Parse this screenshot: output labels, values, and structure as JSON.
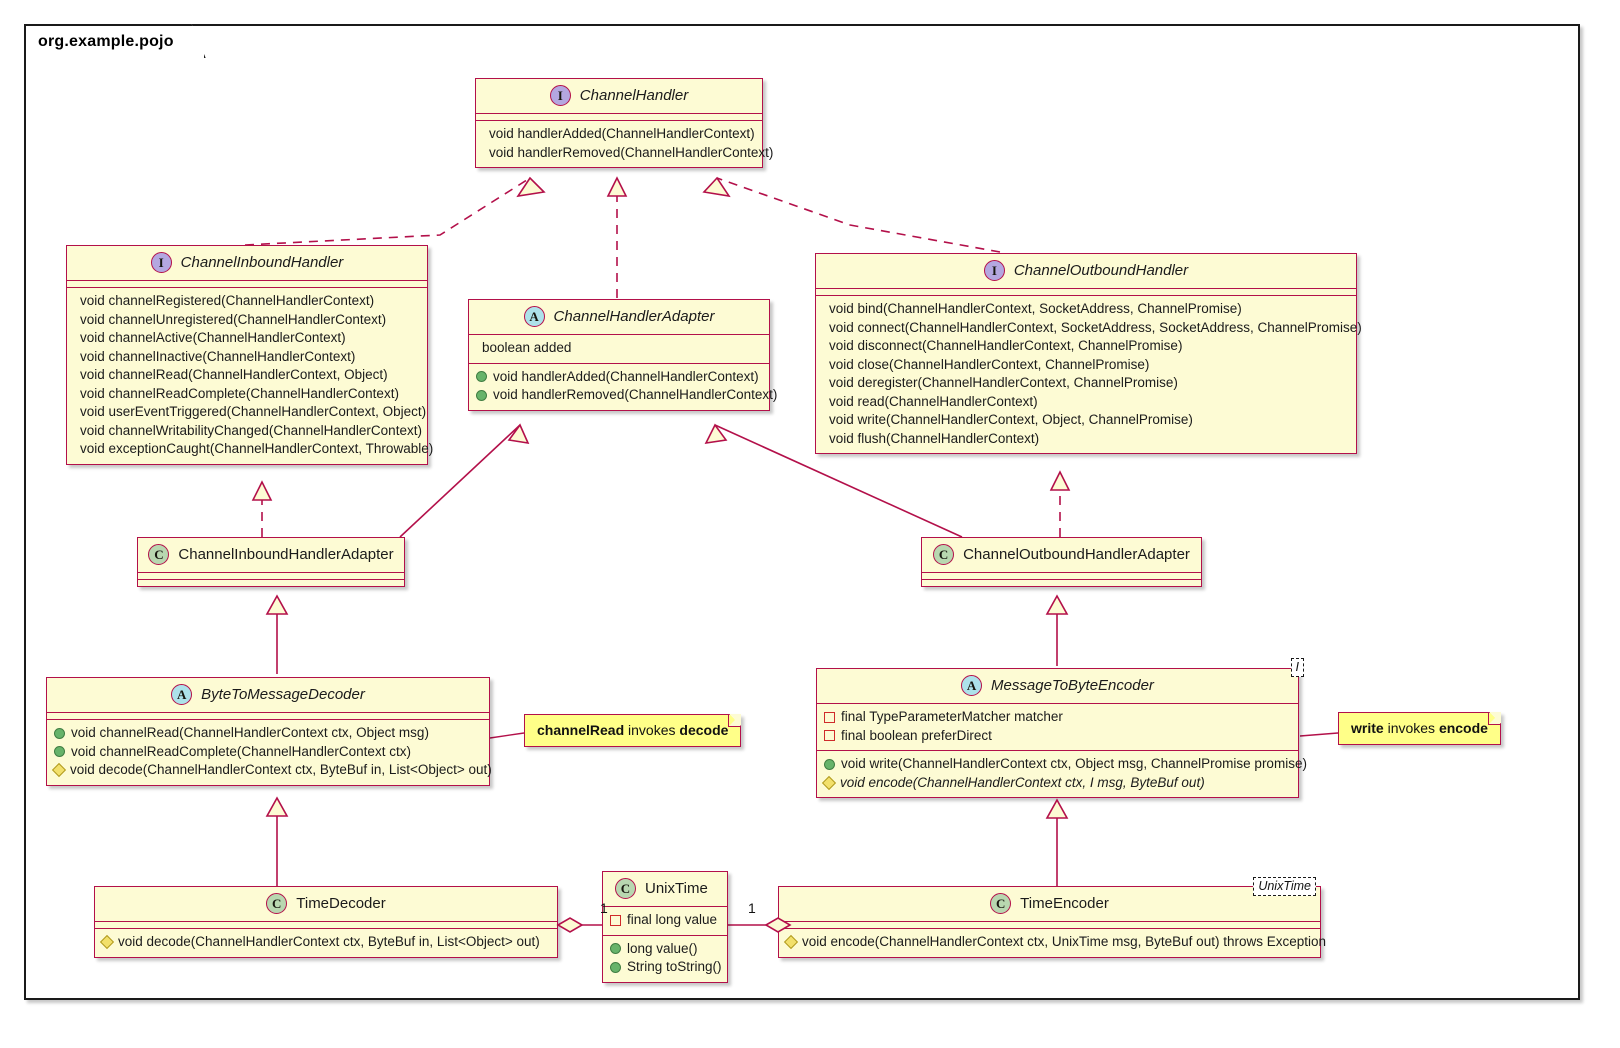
{
  "package": {
    "name": "org.example.pojo"
  },
  "colors": {
    "class_fill": "#fdfbd4",
    "class_border": "#b3104a",
    "note_fill": "#ffff88",
    "interface_icon": "#b4a7e0",
    "abstract_icon": "#ade2ea",
    "class_icon": "#b8d7b0",
    "public_marker": "#67b36a",
    "protected_marker": "#f2e06a",
    "private_marker": "#cf2b2b"
  },
  "classes": {
    "channel_handler": {
      "stereotype": "I",
      "name": "ChannelHandler",
      "fields": [],
      "methods": [
        {
          "visibility": "none",
          "text": "void handlerAdded(ChannelHandlerContext)"
        },
        {
          "visibility": "none",
          "text": "void handlerRemoved(ChannelHandlerContext)"
        }
      ]
    },
    "channel_inbound_handler": {
      "stereotype": "I",
      "name": "ChannelInboundHandler",
      "fields": [],
      "methods": [
        {
          "visibility": "none",
          "text": "void channelRegistered(ChannelHandlerContext)"
        },
        {
          "visibility": "none",
          "text": "void channelUnregistered(ChannelHandlerContext)"
        },
        {
          "visibility": "none",
          "text": "void channelActive(ChannelHandlerContext)"
        },
        {
          "visibility": "none",
          "text": "void channelInactive(ChannelHandlerContext)"
        },
        {
          "visibility": "none",
          "text": "void channelRead(ChannelHandlerContext, Object)"
        },
        {
          "visibility": "none",
          "text": "void channelReadComplete(ChannelHandlerContext)"
        },
        {
          "visibility": "none",
          "text": "void userEventTriggered(ChannelHandlerContext, Object)"
        },
        {
          "visibility": "none",
          "text": "void channelWritabilityChanged(ChannelHandlerContext)"
        },
        {
          "visibility": "none",
          "text": "void exceptionCaught(ChannelHandlerContext, Throwable)"
        }
      ]
    },
    "channel_handler_adapter": {
      "stereotype": "A",
      "name": "ChannelHandlerAdapter",
      "fields": [
        {
          "visibility": "none",
          "text": "boolean added"
        }
      ],
      "methods": [
        {
          "visibility": "public",
          "text": "void handlerAdded(ChannelHandlerContext)"
        },
        {
          "visibility": "public",
          "text": "void handlerRemoved(ChannelHandlerContext)"
        }
      ]
    },
    "channel_outbound_handler": {
      "stereotype": "I",
      "name": "ChannelOutboundHandler",
      "fields": [],
      "methods": [
        {
          "visibility": "none",
          "text": "void bind(ChannelHandlerContext, SocketAddress, ChannelPromise)"
        },
        {
          "visibility": "none",
          "text": "void connect(ChannelHandlerContext, SocketAddress, SocketAddress, ChannelPromise)"
        },
        {
          "visibility": "none",
          "text": "void disconnect(ChannelHandlerContext, ChannelPromise)"
        },
        {
          "visibility": "none",
          "text": "void close(ChannelHandlerContext, ChannelPromise)"
        },
        {
          "visibility": "none",
          "text": "void deregister(ChannelHandlerContext, ChannelPromise)"
        },
        {
          "visibility": "none",
          "text": "void read(ChannelHandlerContext)"
        },
        {
          "visibility": "none",
          "text": "void write(ChannelHandlerContext, Object, ChannelPromise)"
        },
        {
          "visibility": "none",
          "text": "void flush(ChannelHandlerContext)"
        }
      ]
    },
    "channel_inbound_handler_adapter": {
      "stereotype": "C",
      "name": "ChannelInboundHandlerAdapter",
      "fields": [],
      "methods": []
    },
    "channel_outbound_handler_adapter": {
      "stereotype": "C",
      "name": "ChannelOutboundHandlerAdapter",
      "fields": [],
      "methods": []
    },
    "byte_to_message_decoder": {
      "stereotype": "A",
      "name": "ByteToMessageDecoder",
      "fields": [],
      "methods": [
        {
          "visibility": "public",
          "text": "void channelRead(ChannelHandlerContext ctx, Object msg)"
        },
        {
          "visibility": "public",
          "text": "void channelReadComplete(ChannelHandlerContext ctx)"
        },
        {
          "visibility": "protected",
          "text": "void decode(ChannelHandlerContext ctx, ByteBuf in, List<Object> out)"
        }
      ]
    },
    "message_to_byte_encoder": {
      "stereotype": "A",
      "name": "MessageToByteEncoder",
      "generic": "I",
      "fields": [
        {
          "visibility": "private",
          "text": "final TypeParameterMatcher matcher"
        },
        {
          "visibility": "private",
          "text": "final boolean preferDirect"
        }
      ],
      "methods": [
        {
          "visibility": "public",
          "text": "void write(ChannelHandlerContext ctx, Object msg, ChannelPromise promise)"
        },
        {
          "visibility": "protected",
          "italic": true,
          "text": "void encode(ChannelHandlerContext ctx, I msg, ByteBuf out)"
        }
      ]
    },
    "time_decoder": {
      "stereotype": "C",
      "name": "TimeDecoder",
      "fields": [],
      "methods": [
        {
          "visibility": "protected",
          "text": "void decode(ChannelHandlerContext ctx, ByteBuf in, List<Object> out)"
        }
      ]
    },
    "unix_time": {
      "stereotype": "C",
      "name": "UnixTime",
      "fields": [
        {
          "visibility": "private",
          "text": "final long value"
        }
      ],
      "methods": [
        {
          "visibility": "public",
          "text": "long value()"
        },
        {
          "visibility": "public",
          "text": "String toString()"
        }
      ]
    },
    "time_encoder": {
      "stereotype": "C",
      "name": "TimeEncoder",
      "generic": "UnixTime",
      "fields": [],
      "methods": [
        {
          "visibility": "protected",
          "text": "void encode(ChannelHandlerContext ctx, UnixTime msg, ByteBuf out) throws Exception"
        }
      ]
    }
  },
  "notes": {
    "decode_note": {
      "bold1": "channelRead",
      "plain": " invokes ",
      "bold2": "decode"
    },
    "encode_note": {
      "bold1": "write",
      "plain": " invokes ",
      "bold2": "encode"
    }
  },
  "multiplicities": {
    "decoder_to_unixtime": "1",
    "unixtime_to_encoder": "1"
  }
}
